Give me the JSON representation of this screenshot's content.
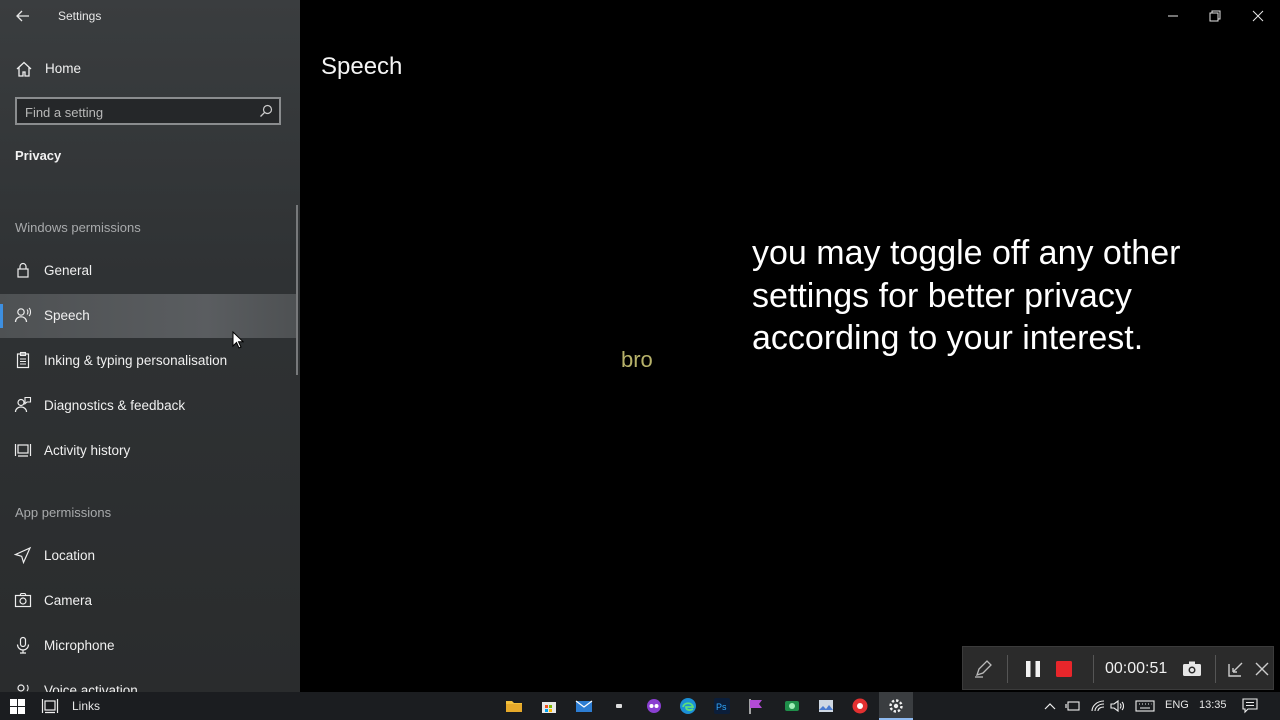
{
  "window": {
    "app_title": "Settings",
    "back_icon": "back-arrow-icon",
    "controls": [
      "minimize-icon",
      "restore-icon",
      "close-icon"
    ]
  },
  "sidebar": {
    "home_label": "Home",
    "search_placeholder": "Find a setting",
    "section_title": "Privacy",
    "windows_permissions_label": "Windows permissions",
    "windows_permissions": [
      {
        "label": "General",
        "icon": "lock-icon"
      },
      {
        "label": "Speech",
        "icon": "speech-person-icon",
        "selected": true
      },
      {
        "label": "Inking & typing personalisation",
        "icon": "clipboard-icon"
      },
      {
        "label": "Diagnostics & feedback",
        "icon": "feedback-person-icon"
      },
      {
        "label": "Activity history",
        "icon": "activity-history-icon"
      }
    ],
    "app_permissions_label": "App permissions",
    "app_permissions": [
      {
        "label": "Location",
        "icon": "location-icon"
      },
      {
        "label": "Camera",
        "icon": "camera-icon"
      },
      {
        "label": "Microphone",
        "icon": "microphone-icon"
      },
      {
        "label": "Voice activation",
        "icon": "voice-activation-icon"
      }
    ]
  },
  "main": {
    "page_title": "Speech",
    "stray_text": "bro",
    "overlay_lines": [
      "you may toggle off any  other",
      "settings for better privacy",
      "according to your interest."
    ]
  },
  "recorder": {
    "timer": "00:00:51"
  },
  "taskbar": {
    "search_label": "Links",
    "tray": {
      "language": "ENG",
      "time": "13:35"
    }
  },
  "colors": {
    "accent_blue": "#3d8fe0",
    "stop_red": "#e8262b",
    "bro_text": "#b7b26a"
  }
}
